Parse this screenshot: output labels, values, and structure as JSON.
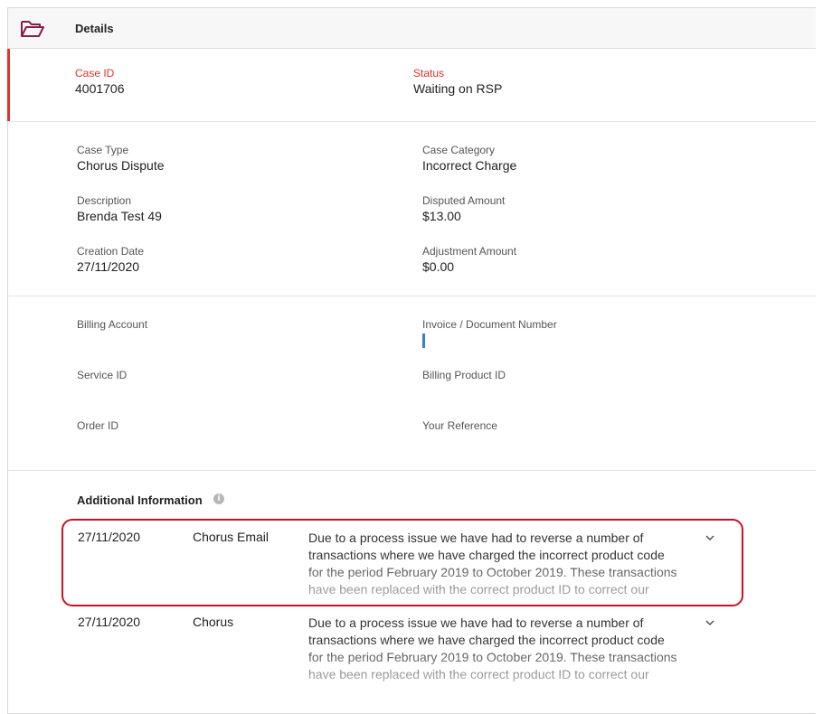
{
  "header": {
    "title": "Details",
    "icon": "folder-icon"
  },
  "status_section": {
    "case_id_label": "Case ID",
    "case_id": "4001706",
    "status_label": "Status",
    "status": "Waiting on RSP"
  },
  "case_section": {
    "case_type_label": "Case Type",
    "case_type": "Chorus Dispute",
    "case_category_label": "Case Category",
    "case_category": "Incorrect Charge",
    "description_label": "Description",
    "description": "Brenda Test 49",
    "disputed_amount_label": "Disputed Amount",
    "disputed_amount": "$13.00",
    "creation_date_label": "Creation Date",
    "creation_date": "27/11/2020",
    "adjustment_amount_label": "Adjustment Amount",
    "adjustment_amount": "$0.00"
  },
  "billing_section": {
    "billing_account_label": "Billing Account",
    "billing_account": "",
    "invoice_label": "Invoice / Document Number",
    "invoice": "",
    "service_id_label": "Service ID",
    "service_id": "",
    "billing_product_id_label": "Billing Product ID",
    "billing_product_id": "",
    "order_id_label": "Order ID",
    "order_id": "",
    "your_reference_label": "Your Reference",
    "your_reference": ""
  },
  "additional": {
    "title": "Additional Information",
    "info_icon_glyph": "i",
    "items": [
      {
        "date": "27/11/2020",
        "source": "Chorus Email",
        "text": "Due to a process issue we have had to reverse a number of transactions where we have charged the incorrect product code for the period February 2019 to October 2019. These transactions have been replaced with the correct product ID to correct our internal"
      },
      {
        "date": "27/11/2020",
        "source": "Chorus",
        "text": "Due to a process issue we have had to reverse a number of transactions where we have charged the incorrect product code for the period February 2019 to October 2019. These transactions have been replaced with the correct product ID to correct our internal"
      }
    ]
  },
  "colors": {
    "accent_red": "#e0342a",
    "folder_icon": "#8a1c4a",
    "highlight_border": "#cc1122",
    "cursor_blue": "#3a7bd5"
  }
}
